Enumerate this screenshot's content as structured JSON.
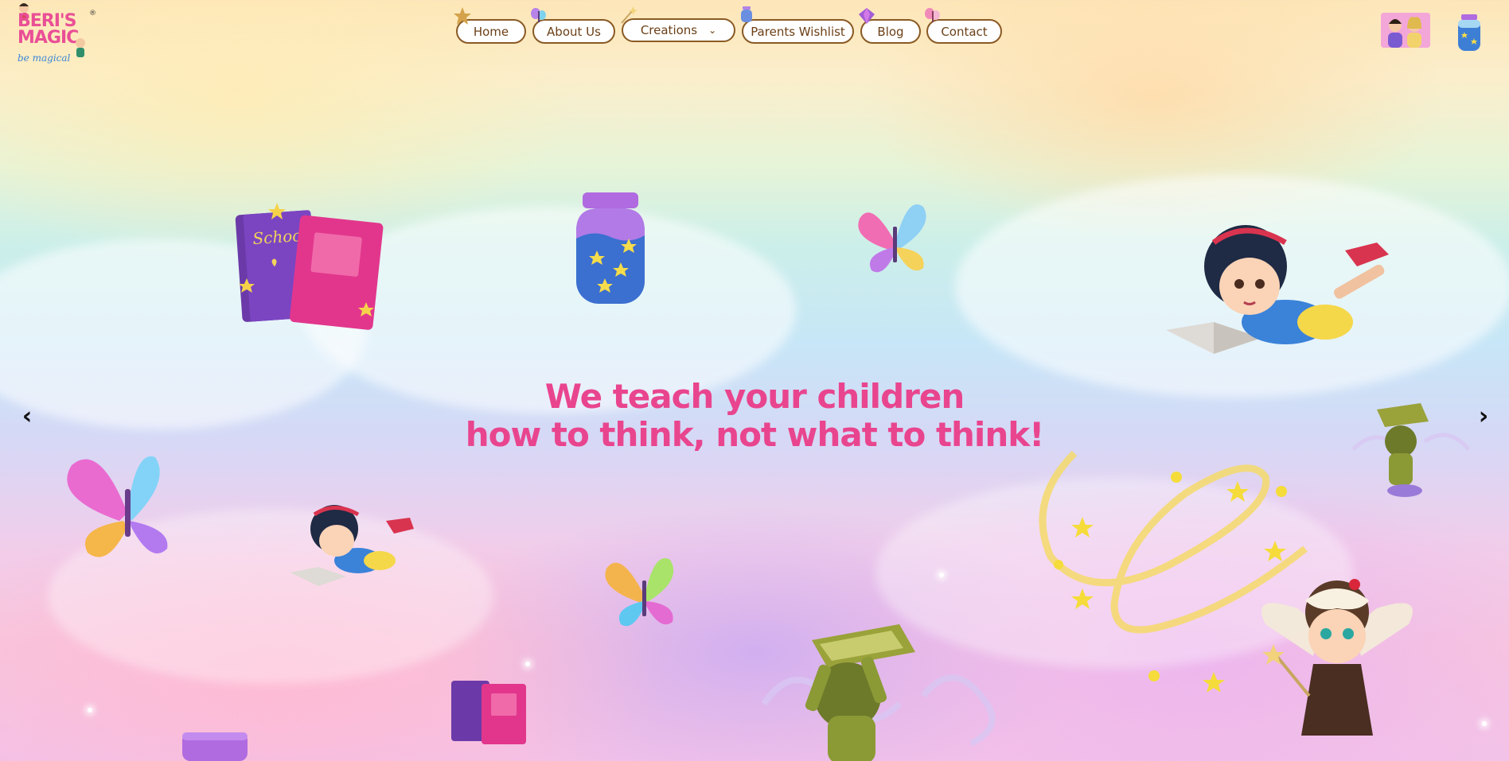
{
  "brand": {
    "name_line1": "BERI'S",
    "name_line2": "MAGIC",
    "tagline": "be magical",
    "registered": "®"
  },
  "nav": {
    "items": [
      {
        "label": "Home"
      },
      {
        "label": "About Us"
      },
      {
        "label": "Creations"
      },
      {
        "label": "Parents Wishlist"
      },
      {
        "label": "Blog"
      },
      {
        "label": "Contact"
      }
    ],
    "creations_chevron": "⌄"
  },
  "slider": {
    "prev_arrow": "‹",
    "next_arrow": "›",
    "headline_line1": "We teach your children",
    "headline_line2": "how to think, not what to think!"
  },
  "illustrations": {
    "book_label": "School"
  },
  "colors": {
    "headline": "#e9458f",
    "nav_border": "#8a5a24",
    "brand_pink": "#e94f96",
    "brand_blue": "#3a86d6"
  }
}
